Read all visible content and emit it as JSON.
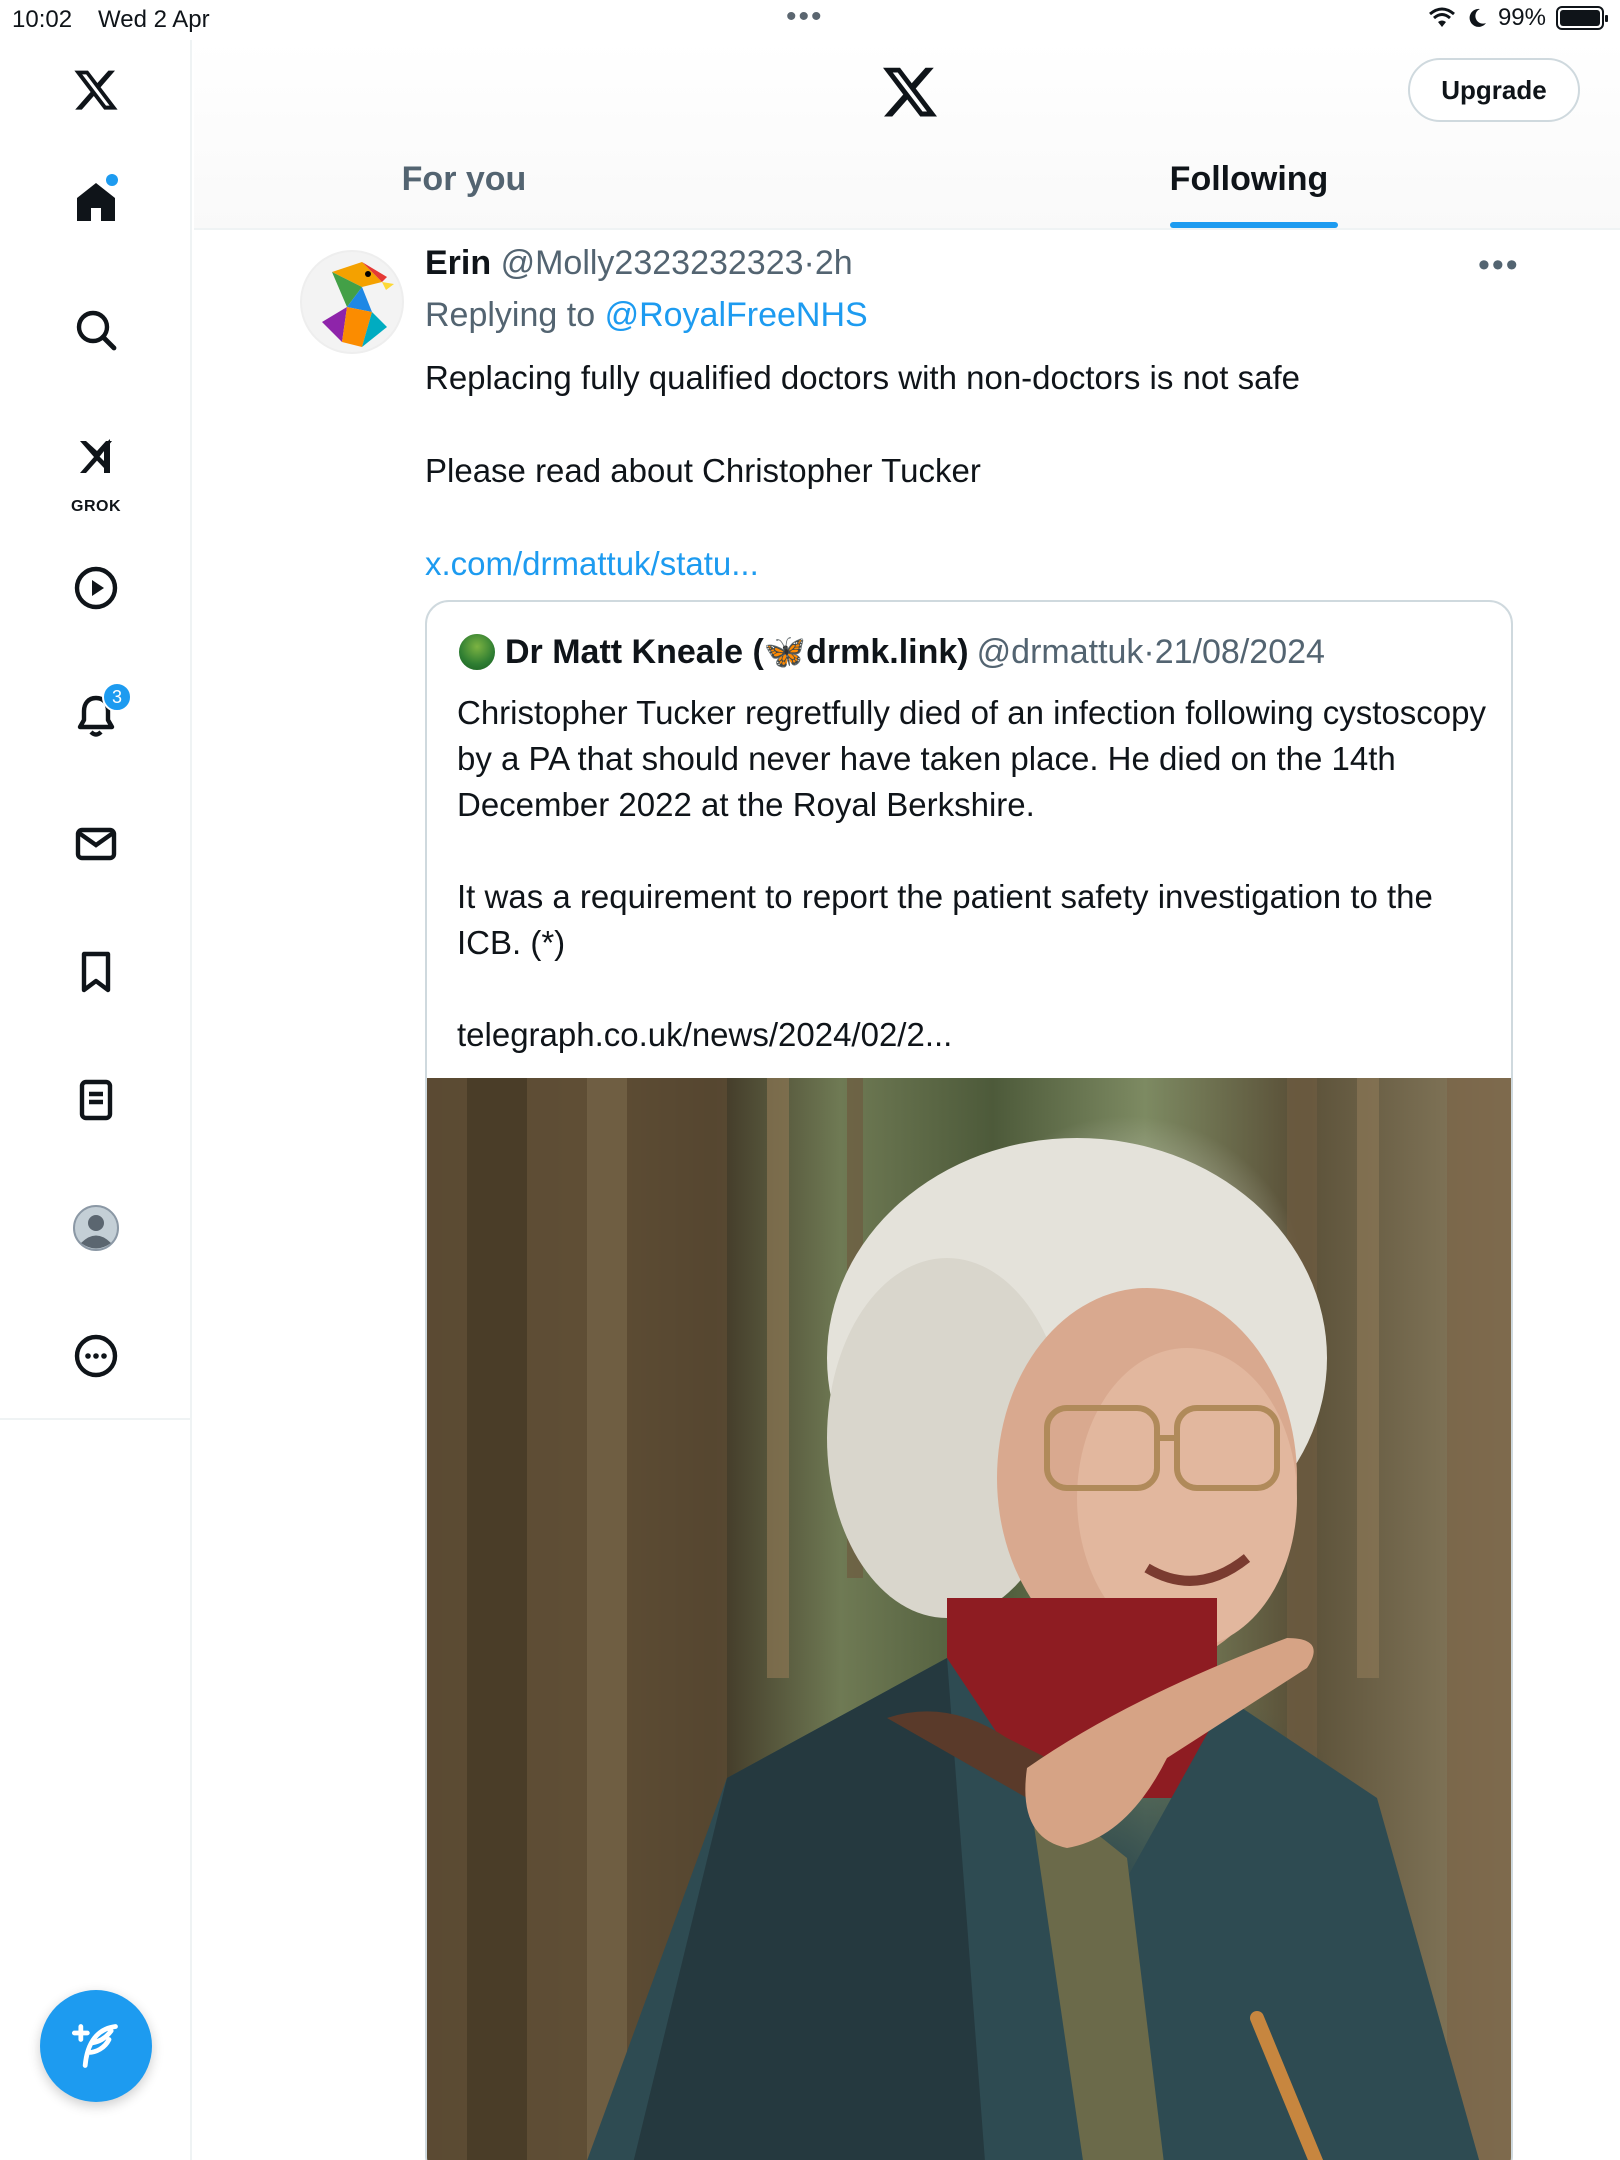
{
  "status_bar": {
    "time": "10:02",
    "date": "Wed 2 Apr",
    "battery": "99%"
  },
  "sidebar": {
    "items": [
      {
        "name": "home",
        "icon": "home-icon"
      },
      {
        "name": "search",
        "icon": "search-icon"
      },
      {
        "name": "grok",
        "icon": "grok-icon",
        "label": "GROK"
      },
      {
        "name": "videos",
        "icon": "play-icon"
      },
      {
        "name": "notifications",
        "icon": "bell-icon",
        "badge": "3"
      },
      {
        "name": "messages",
        "icon": "mail-icon"
      },
      {
        "name": "bookmarks",
        "icon": "bookmark-icon"
      },
      {
        "name": "lists",
        "icon": "list-icon"
      },
      {
        "name": "profile",
        "icon": "profile-icon"
      },
      {
        "name": "more",
        "icon": "more-icon"
      }
    ],
    "compose_icon": "compose-icon"
  },
  "header": {
    "upgrade_label": "Upgrade",
    "tabs": [
      {
        "label": "For you",
        "active": false
      },
      {
        "label": "Following",
        "active": true
      }
    ]
  },
  "tweet": {
    "author_name": "Erin",
    "author_handle": "@Molly2323232323",
    "separator": "·",
    "time": "2h",
    "replying_prefix": "Replying to",
    "replying_handle": "@RoyalFreeNHS",
    "paragraphs": [
      "Replacing fully qualified doctors with non-doctors is not safe",
      "Please read about Christopher Tucker"
    ],
    "link": "x.com/drmattuk/statu..."
  },
  "quote": {
    "author_name": "Dr Matt Kneale (🦋drmk.link)",
    "author_handle": "@drmattuk",
    "separator": "·",
    "date": "21/08/2024",
    "paragraphs": [
      "Christopher Tucker regretfully died of an infection following cystoscopy by a PA that should never have taken place. He died on the 14th December 2022 at the Royal Berkshire.",
      "It was a requirement to report the patient safety investigation to the ICB. (*)",
      "telegraph.co.uk/news/2024/02/2..."
    ]
  },
  "colors": {
    "accent": "#1d9bf0",
    "text_primary": "#0f1419",
    "text_secondary": "#536471",
    "border": "#cfd9de"
  }
}
